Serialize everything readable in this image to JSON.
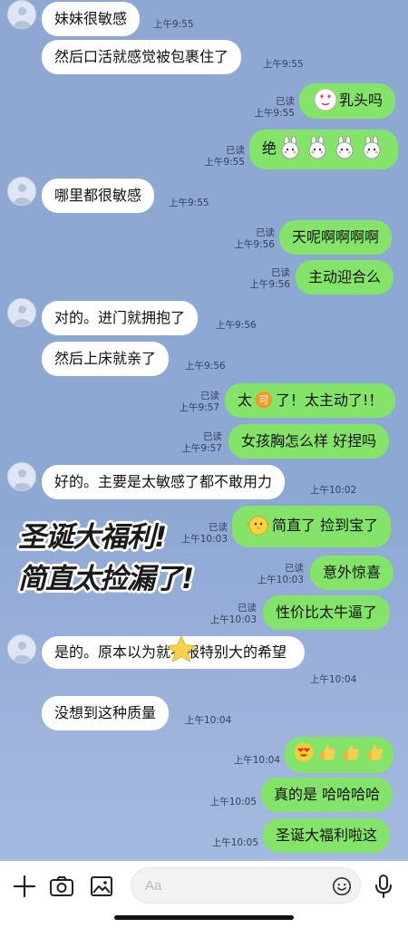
{
  "messages": [
    {
      "side": "in",
      "avatar": true,
      "text": "妹妹很敏感",
      "time": "上午9:55"
    },
    {
      "side": "in",
      "avatar": false,
      "text": "然后口活就感觉被包裹住了",
      "time": "上午9:55"
    },
    {
      "side": "out",
      "read": "已读",
      "text": "乳头吗",
      "time": "上午9:55",
      "emoji": "heart-eyes-face-sticker"
    },
    {
      "side": "out",
      "read": "已读",
      "text": "绝",
      "time": "上午9:55",
      "emoji": "bunny-sticker x4"
    },
    {
      "side": "in",
      "avatar": true,
      "text": "哪里都很敏感",
      "time": "上午9:55"
    },
    {
      "side": "out",
      "read": "已读",
      "text": "天呢啊啊啊啊",
      "time": "上午9:56"
    },
    {
      "side": "out",
      "read": "已读",
      "text": "主动迎合么",
      "time": "上午9:56"
    },
    {
      "side": "in",
      "avatar": true,
      "text": "对的。进门就拥抱了",
      "time": "上午9:56"
    },
    {
      "side": "in",
      "avatar": false,
      "text": "然后上床就亲了",
      "time": "上午9:56"
    },
    {
      "side": "out",
      "read": "已读",
      "text_a": "太",
      "text_b": "了！太主动了!！",
      "time": "上午9:57",
      "emoji": "ke-badge"
    },
    {
      "side": "out",
      "read": "已读",
      "text": "女孩胸怎么样 好捏吗",
      "time": "上午9:57"
    },
    {
      "side": "in",
      "avatar": true,
      "text": "好的。主要是太敏感了都不敢用力",
      "time": "上午10:02"
    },
    {
      "side": "out",
      "read": "已读",
      "text": "简直了 捡到宝了",
      "time": "上午10:03",
      "emoji": "chick-sticker"
    },
    {
      "side": "out",
      "read": "已读",
      "text": "意外惊喜",
      "time": "上午10:03"
    },
    {
      "side": "out",
      "read": "已读",
      "text": "性价比太牛逼了",
      "time": "上午10:03"
    },
    {
      "side": "in",
      "avatar": true,
      "text": "是的。原本以为就不报特别大的希望",
      "time": "上午10:04"
    },
    {
      "side": "in",
      "avatar": false,
      "text": "没想到这种质量",
      "time": "上午10:04"
    },
    {
      "side": "out",
      "read": "",
      "text": "",
      "time": "上午10:04",
      "emoji": "heart-eyes + thumbs-up x3"
    },
    {
      "side": "out",
      "read": "",
      "text": "真的是 哈哈哈哈",
      "time": "上午10:05"
    },
    {
      "side": "out",
      "read": "",
      "text": "圣诞大福利啦这",
      "time": "上午10:05"
    }
  ],
  "promo": {
    "line1": "圣诞大福利!",
    "line2": "简直太捡漏了!"
  },
  "composer": {
    "placeholder": "Aa"
  },
  "icons": [
    "plus-icon",
    "camera-icon",
    "image-icon",
    "emoji-icon",
    "microphone-icon"
  ],
  "colors": {
    "outgoing": "#84e46a",
    "incoming": "#ffffff",
    "background": "#8fa8d3"
  }
}
